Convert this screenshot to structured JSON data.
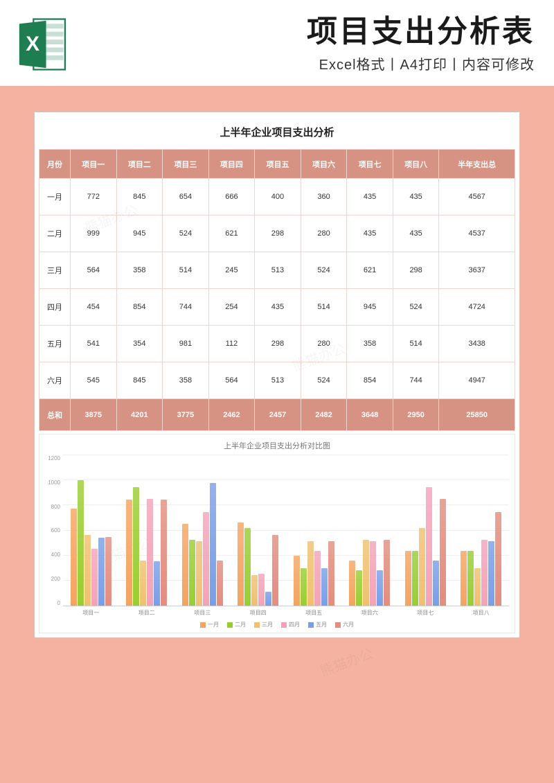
{
  "header": {
    "main_title": "项目支出分析表",
    "sub_title": "Excel格式丨A4打印丨内容可修改"
  },
  "sheet_title": "上半年企业项目支出分析",
  "columns": [
    "月份",
    "项目一",
    "项目二",
    "项目三",
    "项目四",
    "项目五",
    "项目六",
    "项目七",
    "项目八",
    "半年支出总"
  ],
  "rows": [
    {
      "label": "一月",
      "values": [
        772,
        845,
        654,
        666,
        400,
        360,
        435,
        435,
        4567
      ]
    },
    {
      "label": "二月",
      "values": [
        999,
        945,
        524,
        621,
        298,
        280,
        435,
        435,
        4537
      ]
    },
    {
      "label": "三月",
      "values": [
        564,
        358,
        514,
        245,
        513,
        524,
        621,
        298,
        3637
      ]
    },
    {
      "label": "四月",
      "values": [
        454,
        854,
        744,
        254,
        435,
        514,
        945,
        524,
        4724
      ]
    },
    {
      "label": "五月",
      "values": [
        541,
        354,
        981,
        112,
        298,
        280,
        358,
        514,
        3438
      ]
    },
    {
      "label": "六月",
      "values": [
        545,
        845,
        358,
        564,
        513,
        524,
        854,
        744,
        4947
      ]
    }
  ],
  "totals": {
    "label": "总和",
    "values": [
      3875,
      4201,
      3775,
      2462,
      2457,
      2482,
      3648,
      2950,
      25850
    ]
  },
  "chart_data": {
    "type": "bar",
    "title": "上半年企业项目支出分析对比图",
    "xlabel": "",
    "ylabel": "",
    "ylim": [
      0,
      1200
    ],
    "yticks": [
      0,
      200,
      400,
      600,
      800,
      1000,
      1200
    ],
    "categories": [
      "项目一",
      "项目二",
      "项目三",
      "项目四",
      "项目五",
      "项目六",
      "项目七",
      "项目八"
    ],
    "series": [
      {
        "name": "一月",
        "color": "#f4a460",
        "values": [
          772,
          845,
          654,
          666,
          400,
          360,
          435,
          435
        ]
      },
      {
        "name": "二月",
        "color": "#9acd32",
        "values": [
          999,
          945,
          524,
          621,
          298,
          280,
          435,
          435
        ]
      },
      {
        "name": "三月",
        "color": "#f0c070",
        "values": [
          564,
          358,
          514,
          245,
          513,
          524,
          621,
          298
        ]
      },
      {
        "name": "四月",
        "color": "#f3a3b8",
        "values": [
          454,
          854,
          744,
          254,
          435,
          514,
          945,
          524
        ]
      },
      {
        "name": "五月",
        "color": "#7a9ee6",
        "values": [
          541,
          354,
          981,
          112,
          298,
          280,
          358,
          514
        ]
      },
      {
        "name": "六月",
        "color": "#e28d7f",
        "values": [
          545,
          845,
          358,
          564,
          513,
          524,
          854,
          744
        ]
      }
    ]
  },
  "watermark": "熊猫办公"
}
